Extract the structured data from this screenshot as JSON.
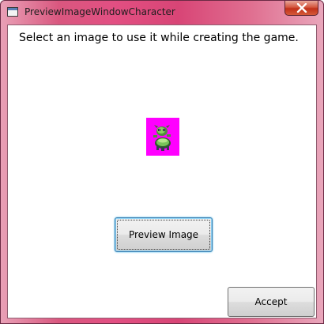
{
  "window": {
    "title": "PreviewImageWindowCharacter"
  },
  "content": {
    "instruction": "Select an image to use it while creating the game.",
    "preview_image": {
      "background": "#ff00ff",
      "icon": "green-creature-sprite"
    },
    "preview_button_label": "Preview Image",
    "accept_button_label": "Accept"
  },
  "colors": {
    "frame_accent": "#e24f82",
    "close_button": "#c1301a",
    "focus_ring": "#3c7fb1"
  }
}
